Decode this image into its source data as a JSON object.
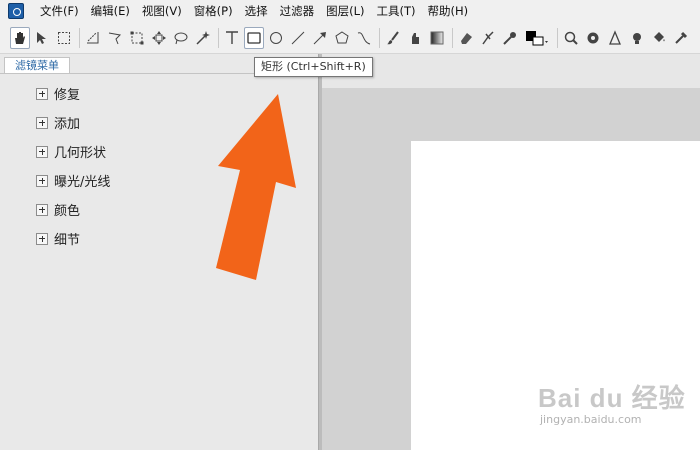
{
  "menu": [
    "文件(F)",
    "编辑(E)",
    "视图(V)",
    "窗格(P)",
    "选择",
    "过滤器",
    "图层(L)",
    "工具(T)",
    "帮助(H)"
  ],
  "tooltip": "矩形 (Ctrl+Shift+R)",
  "panel": {
    "tab_label": "滤镜菜单",
    "tree": [
      "修复",
      "添加",
      "几何形状",
      "曝光/光线",
      "颜色",
      "细节"
    ]
  },
  "toolbar_icons": [
    "hand-icon",
    "move-selection-icon",
    "crop-select-icon",
    "transform-icon",
    "lasso-polygon-icon",
    "resize-icon",
    "move-icon",
    "lasso-icon",
    "magic-wand-icon",
    "text-icon",
    "rectangle-icon",
    "ellipse-icon",
    "line-icon",
    "arrow-icon",
    "polygon-icon",
    "curve-icon",
    "brush-icon",
    "smudge-icon",
    "gradient-icon",
    "eraser-icon",
    "clone-icon",
    "color-picker-icon",
    "color-swatch-icon",
    "zoom-icon",
    "settings-icon",
    "perspective-icon",
    "bulb-icon",
    "bucket-icon",
    "dropper-icon"
  ],
  "watermark": {
    "main": "Bai du 经验",
    "sub": "jingyan.baidu.com"
  },
  "colors": {
    "arrow": "#f26419",
    "tab_text": "#2e6aa6",
    "canvas": "#d2d2d2"
  }
}
